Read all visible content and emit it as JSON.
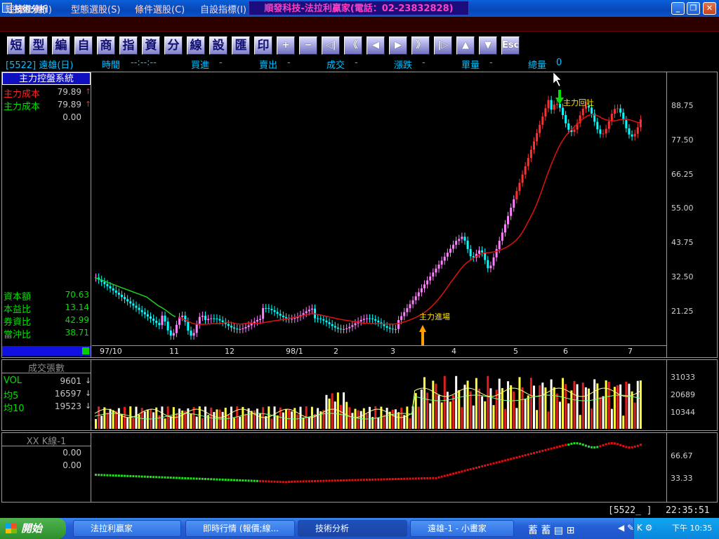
{
  "window": {
    "title": "技術分析",
    "banner": "順發科技-法拉利贏家(電話：02-23832828)",
    "minimize": "_",
    "restore": "❐",
    "close": "✕"
  },
  "menu": [
    "短線法寶(I)",
    "型態選股(S)",
    "條件選股(C)",
    "自設指標(I)"
  ],
  "toolbar": {
    "text_buttons": [
      "短",
      "型",
      "編",
      "自",
      "商",
      "指",
      "資",
      "分",
      "線",
      "設",
      "匯",
      "印"
    ],
    "nav_buttons": [
      "+",
      "−",
      "◁|",
      "《",
      "◀",
      "▶",
      "》",
      "|▷",
      "▲",
      "▼",
      "Esc"
    ]
  },
  "info_strip": {
    "symbol": "[5522] 遠雄(日)",
    "time_label": "時間",
    "time_value": "--:--:--",
    "buy_label": "買進",
    "buy_value": "-",
    "sell_label": "賣出",
    "sell_value": "-",
    "trade_label": "成交",
    "trade_value": "-",
    "change_label": "漲跌",
    "change_value": "-",
    "lot_label": "單量",
    "lot_value": "-",
    "total_label": "總量",
    "total_value": "0"
  },
  "main_panel": {
    "system_title": "主力控盤系統",
    "rows": [
      {
        "label": "主力成本",
        "value": "79.89",
        "arrow": "↑",
        "color": "#ff2020"
      },
      {
        "label": "主力成本",
        "value": "79.89",
        "arrow": "↑",
        "color": "#00e000"
      },
      {
        "label": "",
        "value": "0.00",
        "arrow": "",
        "color": "#c8c8c8"
      }
    ],
    "fundamentals": [
      {
        "label": "資本額",
        "value": "70.63"
      },
      {
        "label": "本益比",
        "value": "13.14"
      },
      {
        "label": "券資比",
        "value": "42.99"
      },
      {
        "label": "當沖比",
        "value": "38.71"
      }
    ],
    "y_ticks": [
      "88.75",
      "77.50",
      "66.25",
      "55.00",
      "43.75",
      "32.50",
      "21.25"
    ],
    "x_ticks": [
      "97/10",
      "11",
      "12",
      "98/1",
      "2",
      "3",
      "4",
      "5",
      "6",
      "7"
    ],
    "annotation_buy": "主力進場",
    "annotation_sell": "主力回吐"
  },
  "volume_panel": {
    "title": "成交張數",
    "rows": [
      {
        "label": "VOL",
        "value": "9601",
        "arrow": "↓"
      },
      {
        "label": "均5",
        "value": "16597",
        "arrow": "↓"
      },
      {
        "label": "均10",
        "value": "19523",
        "arrow": "↓"
      }
    ],
    "y_ticks": [
      "31033",
      "20689",
      "10344"
    ]
  },
  "indicator_panel": {
    "title": "XX K線-1",
    "values": [
      "0.00",
      "0.00"
    ],
    "y_ticks": [
      "66.67",
      "33.33"
    ]
  },
  "status": {
    "code": "[5522_ ]",
    "clock": "22:35:51"
  },
  "taskbar": {
    "start": "開始",
    "tasks": [
      "法拉利贏家",
      "即時行情 (報價;線...",
      "技術分析",
      "遠雄-1 - 小畫家"
    ],
    "time": "下午 10:35"
  },
  "colors": {
    "up": "#ff2020",
    "down": "#00e000",
    "ma_red": "#e01010",
    "ma_green": "#20d020",
    "candle_up": "#ff80ff",
    "candle_down": "#00ffff"
  }
}
